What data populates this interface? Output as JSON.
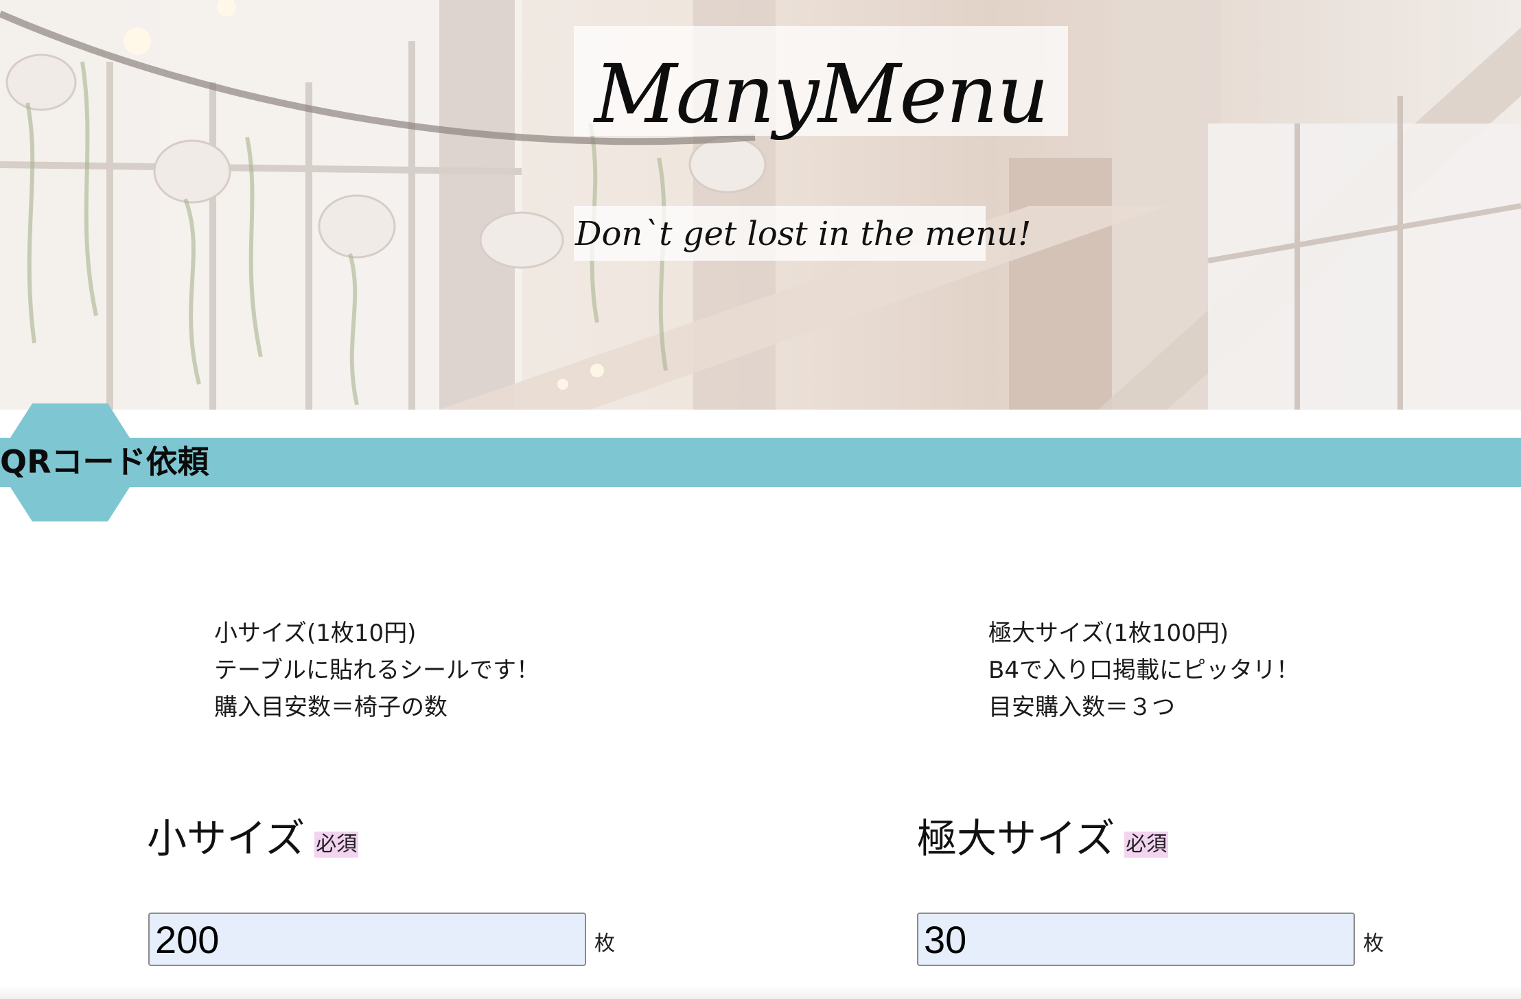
{
  "header": {
    "brand": "ManyMenu",
    "tagline": "Don`t get lost in the menu!"
  },
  "section": {
    "title": "QRコード依頼"
  },
  "products": {
    "small": {
      "lines": [
        "小サイズ(1枚10円)",
        "テーブルに貼れるシールです！",
        "購入目安数＝椅子の数"
      ],
      "field_label": "小サイズ",
      "required_badge": "必須",
      "value": "200",
      "unit": "枚"
    },
    "large": {
      "lines": [
        "極大サイズ(1枚100円)",
        "B4で入り口掲載にピッタリ！",
        "目安購入数＝３つ"
      ],
      "field_label": "極大サイズ",
      "required_badge": "必須",
      "value": "30",
      "unit": "枚"
    }
  },
  "colors": {
    "section_bar": "#7ec6d2",
    "required_badge_bg": "#f3d4f0",
    "input_bg": "#e6eefc"
  }
}
